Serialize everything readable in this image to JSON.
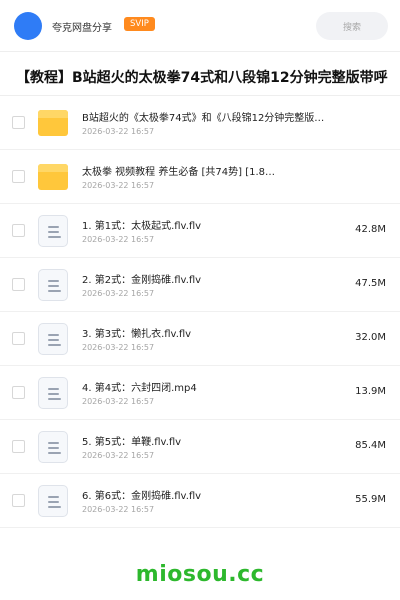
{
  "header": {
    "share_name": "夸克网盘分享",
    "badge": "SVIP",
    "search_placeholder": "搜索"
  },
  "title": "【教程】B站超火的太极拳74式和八段锦12分钟完整版带呼",
  "files": [
    {
      "type": "folder",
      "name": "B站超火的《太极拳74式》和《八段锦12分钟完整版…",
      "date": "2026-03-22 16:57",
      "size": ""
    },
    {
      "type": "folder",
      "name": "太极拳 视频教程 养生必备 [共74势] [1.8…",
      "date": "2026-03-22 16:57",
      "size": ""
    },
    {
      "type": "file",
      "name": "1. 第1式：太极起式.flv.flv",
      "date": "2026-03-22 16:57",
      "size": "42.8M"
    },
    {
      "type": "file",
      "name": "2. 第2式：金刚捣碓.flv.flv",
      "date": "2026-03-22 16:57",
      "size": "47.5M"
    },
    {
      "type": "file",
      "name": "3. 第3式：懒扎衣.flv.flv",
      "date": "2026-03-22 16:57",
      "size": "32.0M"
    },
    {
      "type": "file",
      "name": "4. 第4式：六封四闭.mp4",
      "date": "2026-03-22 16:57",
      "size": "13.9M"
    },
    {
      "type": "file",
      "name": "5. 第5式：单鞭.flv.flv",
      "date": "2026-03-22 16:57",
      "size": "85.4M"
    },
    {
      "type": "file",
      "name": "6. 第6式：金刚捣碓.flv.flv",
      "date": "2026-03-22 16:57",
      "size": "55.9M"
    }
  ],
  "watermark": "miosou.cc",
  "colors": {
    "accent": "#2f7cf6",
    "badge": "#ff8a1e",
    "folder": "#ffc73b",
    "watermark": "#2db82d"
  }
}
